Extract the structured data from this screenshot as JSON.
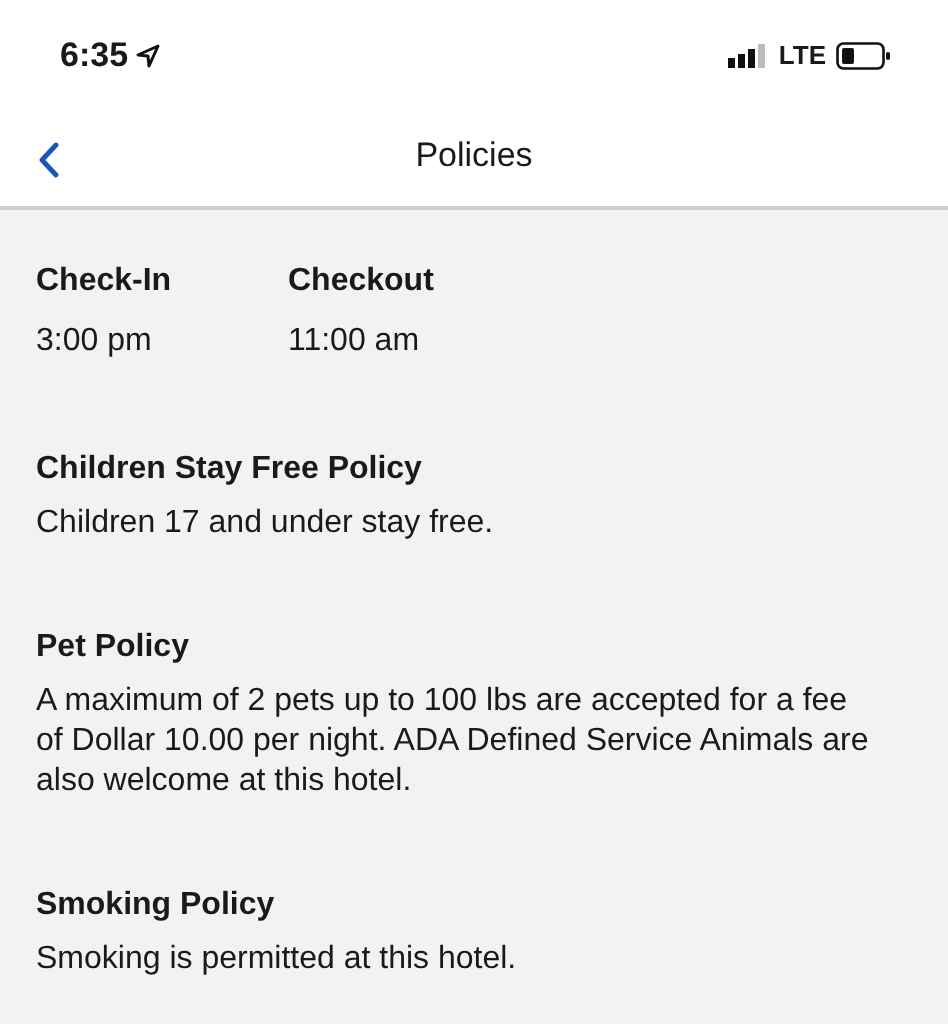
{
  "status_bar": {
    "time": "6:35",
    "network": "LTE"
  },
  "nav": {
    "title": "Policies"
  },
  "times": [
    {
      "label": "Check-In",
      "value": "3:00 pm"
    },
    {
      "label": "Checkout",
      "value": "11:00 am"
    }
  ],
  "policies": [
    {
      "title": "Children Stay Free Policy",
      "text": "Children 17 and under stay free."
    },
    {
      "title": "Pet Policy",
      "text": "A maximum of 2 pets up to 100 lbs are accepted for a fee of Dollar 10.00 per night. ADA Defined Service Animals are also welcome at this hotel."
    },
    {
      "title": "Smoking Policy",
      "text": "Smoking is permitted at this hotel."
    }
  ]
}
